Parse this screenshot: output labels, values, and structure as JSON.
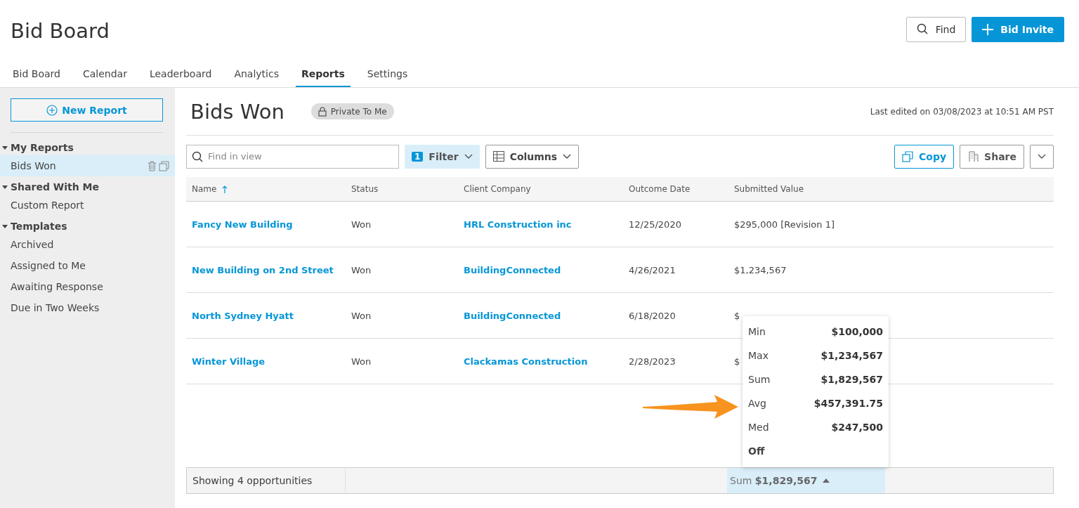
{
  "header": {
    "title": "Bid Board",
    "find_button": "Find",
    "invite_button": "Bid Invite"
  },
  "tabs": [
    {
      "label": "Bid Board",
      "selected": false
    },
    {
      "label": "Calendar",
      "selected": false
    },
    {
      "label": "Leaderboard",
      "selected": false
    },
    {
      "label": "Analytics",
      "selected": false
    },
    {
      "label": "Reports",
      "selected": true
    },
    {
      "label": "Settings",
      "selected": false
    }
  ],
  "sidebar": {
    "new_button": "New Report",
    "sections": [
      {
        "title": "My Reports",
        "expanded": true,
        "items": [
          {
            "label": "Bids Won",
            "selected": true
          }
        ]
      },
      {
        "title": "Shared With Me",
        "expanded": true,
        "items": [
          {
            "label": "Custom Report",
            "selected": false
          }
        ]
      },
      {
        "title": "Templates",
        "expanded": true,
        "items": [
          {
            "label": "Archived",
            "selected": false
          },
          {
            "label": "Assigned to Me",
            "selected": false
          },
          {
            "label": "Awaiting Response",
            "selected": false
          },
          {
            "label": "Due in Two Weeks",
            "selected": false
          }
        ]
      }
    ]
  },
  "report": {
    "title": "Bids Won",
    "privacy_badge": "Private To Me",
    "last_edited": "Last edited on 03/08/2023 at 10:51 AM PST",
    "search": {
      "placeholder": "Find in view"
    },
    "filter_count": "1",
    "filter_button": "Filter",
    "columns_button": "Columns",
    "copy_button": "Copy",
    "share_button": "Share"
  },
  "table": {
    "columns": [
      {
        "label": "Name",
        "sorted": true
      },
      {
        "label": "Status",
        "sorted": false
      },
      {
        "label": "Client Company",
        "sorted": false
      },
      {
        "label": "Outcome Date",
        "sorted": false
      },
      {
        "label": "Submitted Value",
        "sorted": false
      }
    ],
    "rows": [
      [
        "Fancy New Building",
        "Won",
        "HRL Construction inc",
        "12/25/2020",
        "$295,000 [Revision 1]"
      ],
      [
        "New Building on 2nd Street",
        "Won",
        "BuildingConnected",
        "4/26/2021",
        "$1,234,567"
      ],
      [
        "North Sydney Hyatt",
        "Won",
        "BuildingConnected",
        "6/18/2020",
        "$"
      ],
      [
        "Winter Village",
        "Won",
        "Clackamas Construction",
        "2/28/2023",
        "$"
      ]
    ]
  },
  "status_bar": {
    "count": "Showing 4 opportunities",
    "summary": "Sum **$1,829,567**"
  },
  "summary_menu": [
    {
      "kind": "stat",
      "label": "Min",
      "value": "$100,000"
    },
    {
      "kind": "stat",
      "label": "Max",
      "value": "$1,234,567"
    },
    {
      "kind": "stat",
      "label": "Sum",
      "value": "$1,829,567"
    },
    {
      "kind": "stat",
      "label": "Avg",
      "value": "$457,391.75"
    },
    {
      "kind": "stat",
      "label": "Med",
      "value": "$247,500"
    },
    {
      "kind": "off",
      "label": "Off"
    }
  ]
}
